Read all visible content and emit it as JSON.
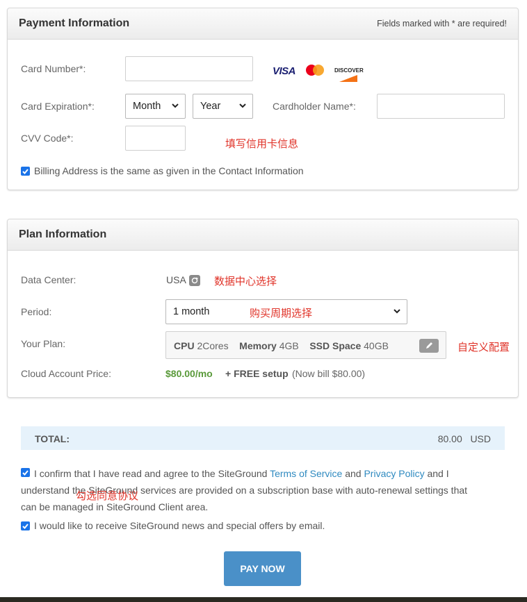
{
  "payment": {
    "title": "Payment Information",
    "required_note": "Fields marked with * are required!",
    "card_number_label": "Card Number*:",
    "card_expiration_label": "Card Expiration*:",
    "month_value": "Month",
    "year_value": "Year",
    "cardholder_label": "Cardholder Name*:",
    "cvv_label": "CVV Code*:",
    "annotation": "填写信用卡信息",
    "billing_label": "Billing Address is the same as given in the Contact Information",
    "card_logos": {
      "visa": "VISA",
      "mastercard": "mastercard-logo",
      "discover": "DISCOVER"
    }
  },
  "plan": {
    "title": "Plan Information",
    "data_center_label": "Data Center:",
    "data_center_value": "USA",
    "data_center_annotation": "数据中心选择",
    "period_label": "Period:",
    "period_value": "1 month",
    "period_annotation": "购买周期选择",
    "your_plan_label": "Your Plan:",
    "cpu_label": "CPU",
    "cpu_value": "2Cores",
    "memory_label": "Memory",
    "memory_value": "4GB",
    "ssd_label": "SSD Space",
    "ssd_value": "40GB",
    "plan_annotation": "自定义配置",
    "price_label": "Cloud Account Price:",
    "price_value": "$80.00/mo",
    "setup_value": "+ FREE setup",
    "bill_note": "(Now bill $80.00)"
  },
  "total": {
    "label": "TOTAL:",
    "amount": "80.00",
    "currency": "USD"
  },
  "agreement": {
    "text_1": "I confirm that I have read and agree to the SiteGround ",
    "tos_link": "Terms of Service",
    "and": " and ",
    "privacy_link": "Privacy Policy",
    "text_2": " and I",
    "line_2": "understand the SiteGround services are provided on a subscription base with auto-renewal settings that",
    "line_3": "can be managed in SiteGround Client area.",
    "annotation": "勾选同意协议",
    "newsletter": "I would like to receive SiteGround news and special offers by email."
  },
  "pay_button": "PAY NOW",
  "colors": {
    "accent": "#4a90c8",
    "price_green": "#5a9a3a",
    "annotation_red": "#e0342a",
    "total_bg": "#e6f2fb"
  }
}
